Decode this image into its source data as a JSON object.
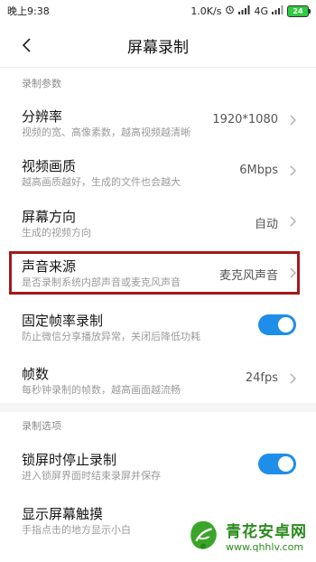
{
  "statusbar": {
    "time": "晚上9:38",
    "speed": "1.0K/s",
    "network": "4G",
    "battery": "24"
  },
  "header": {
    "title": "屏幕录制"
  },
  "sections": {
    "params_label": "录制参数",
    "options_label": "录制选项"
  },
  "rows": {
    "resolution": {
      "title": "分辨率",
      "desc": "视频的宽、高像素数，越高视频越清晰",
      "value": "1920*1080"
    },
    "quality": {
      "title": "视频画质",
      "desc": "越高画质越好，生成的文件也会越大",
      "value": "6Mbps"
    },
    "orientation": {
      "title": "屏幕方向",
      "desc": "生成的视频方向",
      "value": "自动"
    },
    "audio": {
      "title": "声音来源",
      "desc": "是否录制系统内部声音或麦克风声音",
      "value": "麦克风声音"
    },
    "fixed_fps": {
      "title": "固定帧率录制",
      "desc": "防止微信分享播放异常，关闭后降低功耗",
      "toggle": true
    },
    "fps": {
      "title": "帧数",
      "desc": "每秒钟录制的帧数，越高画面越流畅",
      "value": "24fps"
    },
    "lock_stop": {
      "title": "锁屏时停止录制",
      "desc": "进入锁屏界面时结束录屏并保存",
      "toggle": true
    },
    "show_touch": {
      "title": "显示屏幕触摸",
      "desc": "手指点击的地方显示小白"
    }
  },
  "watermark": {
    "brand": "青花安卓网",
    "url": "www.qhhlv.com"
  },
  "colors": {
    "accent": "#1e8ee9",
    "highlight": "#a51919",
    "watermark": "#2b8a1e"
  }
}
